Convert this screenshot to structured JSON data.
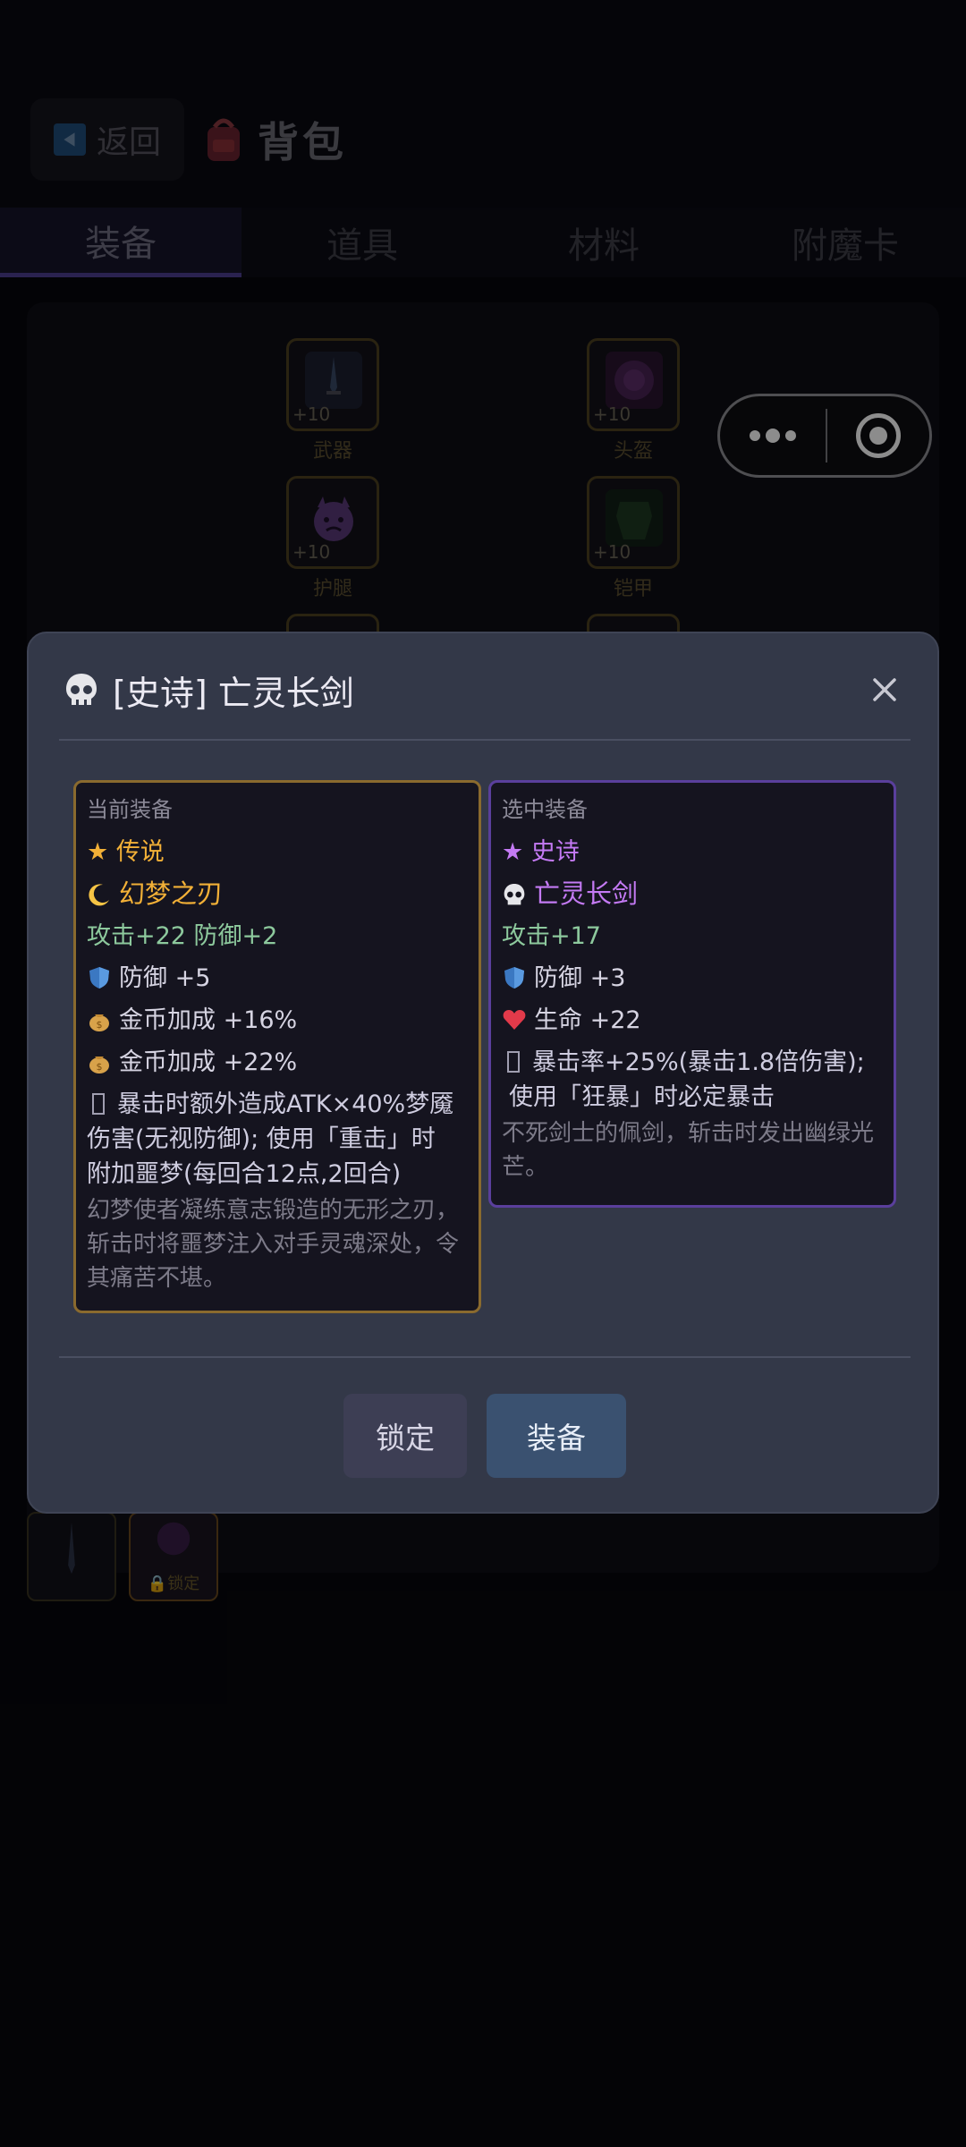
{
  "header": {
    "back_label": "返回",
    "title": "背包"
  },
  "tabs": [
    {
      "label": "装备",
      "active": true
    },
    {
      "label": "道具",
      "active": false
    },
    {
      "label": "材料",
      "active": false
    },
    {
      "label": "附魔卡",
      "active": false
    }
  ],
  "slots": [
    {
      "label": "武器",
      "level": "+10",
      "icon": "sword-icon"
    },
    {
      "label": "头盔",
      "level": "+10",
      "icon": "helmet-icon"
    },
    {
      "label": "护腿",
      "level": "+10",
      "icon": "devil-face-icon"
    },
    {
      "label": "铠甲",
      "level": "+10",
      "icon": "armor-icon"
    }
  ],
  "inventory": {
    "lock_tag": "锁定"
  },
  "modal": {
    "title": "[史诗] 亡灵长剑",
    "current": {
      "section_label": "当前装备",
      "rarity": "传说",
      "name": "幻梦之刃",
      "base_stats": "攻击+22 防御+2",
      "bonus1": "防御 +5",
      "bonus2": "金币加成 +16%",
      "bonus3": "金币加成 +22%",
      "skill_line1": "暴击时额外造成ATK×40%梦魇",
      "skill_line2": "伤害(无视防御); 使用「重击」时",
      "skill_line3": "附加噩梦(每回合12点,2回合)",
      "flavor": "幻梦使者凝练意志锻造的无形之刃，斩击时将噩梦注入对手灵魂深处，令其痛苦不堪。"
    },
    "selected": {
      "section_label": "选中装备",
      "rarity": "史诗",
      "name": "亡灵长剑",
      "base_stats": "攻击+17",
      "bonus1": "防御 +3",
      "bonus2": "生命 +22",
      "skill_line1": "暴击率+25%(暴击1.8倍伤害);",
      "skill_line2": "使用「狂暴」时必定暴击",
      "flavor": "不死剑士的佩剑，斩击时发出幽绿光芒。"
    },
    "buttons": {
      "lock": "锁定",
      "equip": "装备"
    }
  },
  "colors": {
    "legendary": "#f2b037",
    "epic": "#c47af4",
    "stat_green": "#8dc99d",
    "modal_bg": "#333848"
  }
}
